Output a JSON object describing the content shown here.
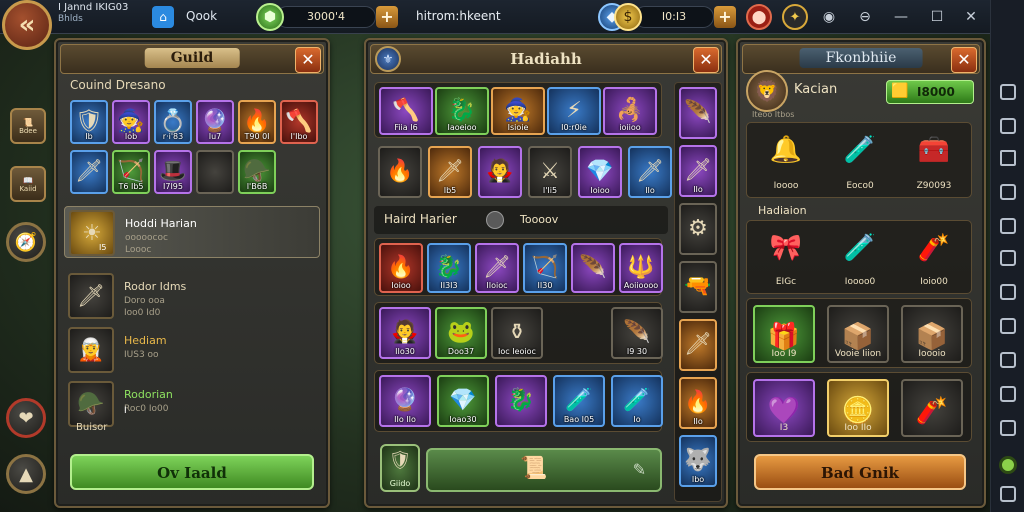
{
  "topbar": {
    "player_name": "I Jannd IKIG03",
    "player_status": "Bhlds",
    "home_label": "Qook",
    "currency1_value": "3000'4",
    "center_title": "hitrom:hkeent",
    "currency2_value": "I0:I3"
  },
  "left_panel": {
    "title": "Guild",
    "section_title": "Couind Dresano",
    "inventory": [
      {
        "label": "Ib",
        "rarity": "r-blue",
        "glyph": "🛡"
      },
      {
        "label": "Iob",
        "rarity": "r-purple",
        "glyph": "🧙"
      },
      {
        "label": "r·i'83",
        "rarity": "r-blue",
        "glyph": "💍"
      },
      {
        "label": "Iu7",
        "rarity": "r-purple",
        "glyph": "🔮"
      },
      {
        "label": "T90 0I",
        "rarity": "r-orange",
        "glyph": "🔥"
      },
      {
        "label": "I'Ibo",
        "rarity": "r-red",
        "glyph": "🪓"
      },
      {
        "label": "",
        "rarity": "r-blue",
        "glyph": "🗡"
      },
      {
        "label": "T6 Ib5",
        "rarity": "r-green",
        "glyph": "🏹"
      },
      {
        "label": "I7I95",
        "rarity": "r-purple",
        "glyph": "🎩"
      },
      {
        "label": "",
        "rarity": "r-dark",
        "glyph": ""
      },
      {
        "label": "I'B6B",
        "rarity": "r-green",
        "glyph": "🪖"
      }
    ],
    "selected": {
      "name": "Hoddi Harian",
      "sub": "ooooococ",
      "sub2": "Loooc",
      "count": "I5"
    },
    "members": [
      {
        "name": "Rodor Idms",
        "sub": "Doro ooa",
        "sub2": "Ioo0 Id0",
        "color": "#e6d9b8",
        "glyph": "🗡"
      },
      {
        "name": "Hediam",
        "sub": "IUS3 oo",
        "sub2": "",
        "color": "#e9b84a",
        "glyph": "🧝"
      },
      {
        "name": "Rodorian",
        "sub": "Roc0 Io00",
        "sub2": "",
        "color": "#8ee060",
        "glyph": "🪖"
      }
    ],
    "last_label": "Buisor",
    "last_count": "I",
    "join_button": "Ov Iaald"
  },
  "mid_panel": {
    "title": "Hadiahh",
    "top_group": [
      {
        "label": "Fiia I6",
        "rarity": "r-purple",
        "glyph": "🪓"
      },
      {
        "label": "Iaoeioo",
        "rarity": "r-green",
        "glyph": "🐉"
      },
      {
        "label": "Isioie",
        "rarity": "r-orange",
        "glyph": "🧙"
      },
      {
        "label": "I0:r0ie",
        "rarity": "r-blue",
        "glyph": "⚡"
      },
      {
        "label": "ioiioo",
        "rarity": "r-purple",
        "glyph": "🦂"
      }
    ],
    "row2": [
      {
        "label": "",
        "rarity": "r-dark",
        "glyph": "🔥"
      },
      {
        "label": "Ib5",
        "rarity": "r-orange",
        "glyph": "🗡"
      },
      {
        "label": "",
        "rarity": "r-purple",
        "glyph": "🧛"
      },
      {
        "label": "I'Ii5",
        "rarity": "r-dark",
        "glyph": "⚔"
      },
      {
        "label": "Ioioo",
        "rarity": "r-purple",
        "glyph": "💎"
      },
      {
        "label": "IIo",
        "rarity": "r-blue",
        "glyph": "🗡"
      }
    ],
    "section_label": "Haird Harier",
    "section_value": "Toooov",
    "group2": [
      {
        "label": "Ioioo",
        "rarity": "r-red",
        "glyph": "🔥"
      },
      {
        "label": "II3I3",
        "rarity": "r-blue",
        "glyph": "🐉"
      },
      {
        "label": "IIoioc",
        "rarity": "r-purple",
        "glyph": "🗡"
      },
      {
        "label": "II30",
        "rarity": "r-blue",
        "glyph": "🏹"
      },
      {
        "label": "",
        "rarity": "r-purple",
        "glyph": "🪶"
      },
      {
        "label": "Aoiioooo",
        "rarity": "r-purple",
        "glyph": "🔱"
      }
    ],
    "group3": [
      {
        "label": "IIo30",
        "rarity": "r-purple",
        "glyph": "🧛"
      },
      {
        "label": "Doo37",
        "rarity": "r-green",
        "glyph": "🐸"
      },
      {
        "label": "Ioc Ieoioc",
        "rarity": "r-dark",
        "glyph": "⚱"
      },
      {
        "label": "I9 30",
        "rarity": "r-dark",
        "glyph": "🪶"
      }
    ],
    "group4": [
      {
        "label": "IIo IIo",
        "rarity": "r-purple",
        "glyph": "🔮"
      },
      {
        "label": "Ioao30",
        "rarity": "r-green",
        "glyph": "💎"
      },
      {
        "label": "",
        "rarity": "r-purple",
        "glyph": "🐉"
      },
      {
        "label": "Bao I05",
        "rarity": "r-blue",
        "glyph": "🧪"
      },
      {
        "label": "Io",
        "rarity": "r-blue",
        "glyph": "🧪"
      }
    ],
    "side_col": [
      {
        "label": "",
        "glyph": "🪶",
        "rarity": "r-purple"
      },
      {
        "label": "IIo",
        "glyph": "🗡",
        "rarity": "r-purple"
      },
      {
        "label": "",
        "glyph": "⚙",
        "rarity": "r-dark"
      },
      {
        "label": "",
        "glyph": "🔫",
        "rarity": "r-dark"
      },
      {
        "label": "",
        "glyph": "🗡",
        "rarity": "r-orange"
      },
      {
        "label": "IIo",
        "glyph": "🔥",
        "rarity": "r-orange"
      },
      {
        "label": "Ibo",
        "glyph": "🐺",
        "rarity": "r-blue"
      }
    ],
    "bottom_badge": "Giido"
  },
  "right_panel": {
    "title": "Fkonbhiie",
    "owner_name": "Kacian",
    "owner_sub": "Iteoo Itbos",
    "gold_value": "I8000",
    "group1": [
      {
        "label": "Ioooo",
        "glyph": "🔔",
        "color": "#f2c94c"
      },
      {
        "label": "Eoco0",
        "glyph": "🧪",
        "color": "#4cb3f2"
      },
      {
        "label": "Z90093",
        "glyph": "🧰",
        "color": "#f2c94c"
      }
    ],
    "section_label": "Hadiaion",
    "group2": [
      {
        "label": "EIGc",
        "glyph": "🎀",
        "color": "#f0a8c8"
      },
      {
        "label": "Ioooo0",
        "glyph": "🧪",
        "color": "#c04cf2"
      },
      {
        "label": "Ioio00",
        "glyph": "🧨",
        "color": "#f24c4c"
      }
    ],
    "group3": [
      {
        "label": "Ioo I9",
        "glyph": "🎁",
        "rarity": "r-green"
      },
      {
        "label": "Vooie Iiion",
        "glyph": "📦",
        "rarity": "r-dark"
      },
      {
        "label": "Ioooio",
        "glyph": "📦",
        "rarity": "r-dark"
      }
    ],
    "group4": [
      {
        "label": "I3",
        "glyph": "💜",
        "rarity": "r-purple"
      },
      {
        "label": "Ioo IIo",
        "glyph": "🪙",
        "rarity": "r-gold"
      },
      {
        "label": "",
        "glyph": "🧨",
        "rarity": "r-dark"
      }
    ],
    "action_button": "Bad Gnik"
  }
}
